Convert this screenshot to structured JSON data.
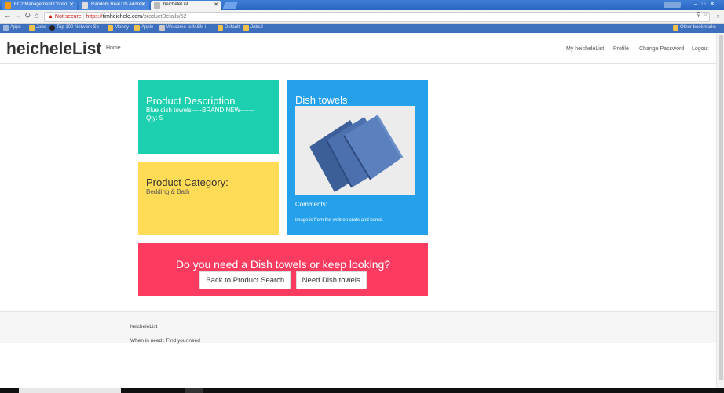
{
  "browser": {
    "tabs": [
      {
        "label": "EC2 Management Conso"
      },
      {
        "label": "Random Real US Addres"
      },
      {
        "label": "heicheleList"
      }
    ],
    "security_label": "Not secure",
    "url_protocol": "https://",
    "url_host": "timheichele.com",
    "url_path": "/productDetails/52",
    "bookmarks": [
      {
        "label": "Apps"
      },
      {
        "label": "Jobs"
      },
      {
        "label": "Top 100 Network Se"
      },
      {
        "label": "Money"
      },
      {
        "label": "Apple"
      },
      {
        "label": "Welcome to M&M i"
      },
      {
        "label": "Default"
      },
      {
        "label": "Jobs2"
      },
      {
        "label": "Other bookmarks"
      }
    ]
  },
  "nav": {
    "brand": "heicheleList",
    "home": "Home",
    "right": [
      "My heicheleList",
      "Profile",
      "Change Password",
      "Logout"
    ]
  },
  "description": {
    "heading": "Product Description",
    "text": "Blue dish towels-----BRAND NEW-------",
    "qty": "Qty: 5"
  },
  "category": {
    "heading": "Product Category:",
    "value": "Bedding & Bath"
  },
  "product": {
    "title": "Dish towels",
    "comments_label": "Comments:",
    "comments": "image is from the web on crate and barrel."
  },
  "cta": {
    "question": "Do you need a Dish towels or keep looking?",
    "back_button": "Back to Product Search",
    "need_button": "Need Dish towels"
  },
  "footer": {
    "line1": "heicheleList",
    "line2": "When in need : Find your need"
  },
  "colors": {
    "description_bg": "#1ccfae",
    "category_bg": "#ffdb56",
    "product_bg": "#25a1eb",
    "cta_bg": "#fc3b61"
  }
}
